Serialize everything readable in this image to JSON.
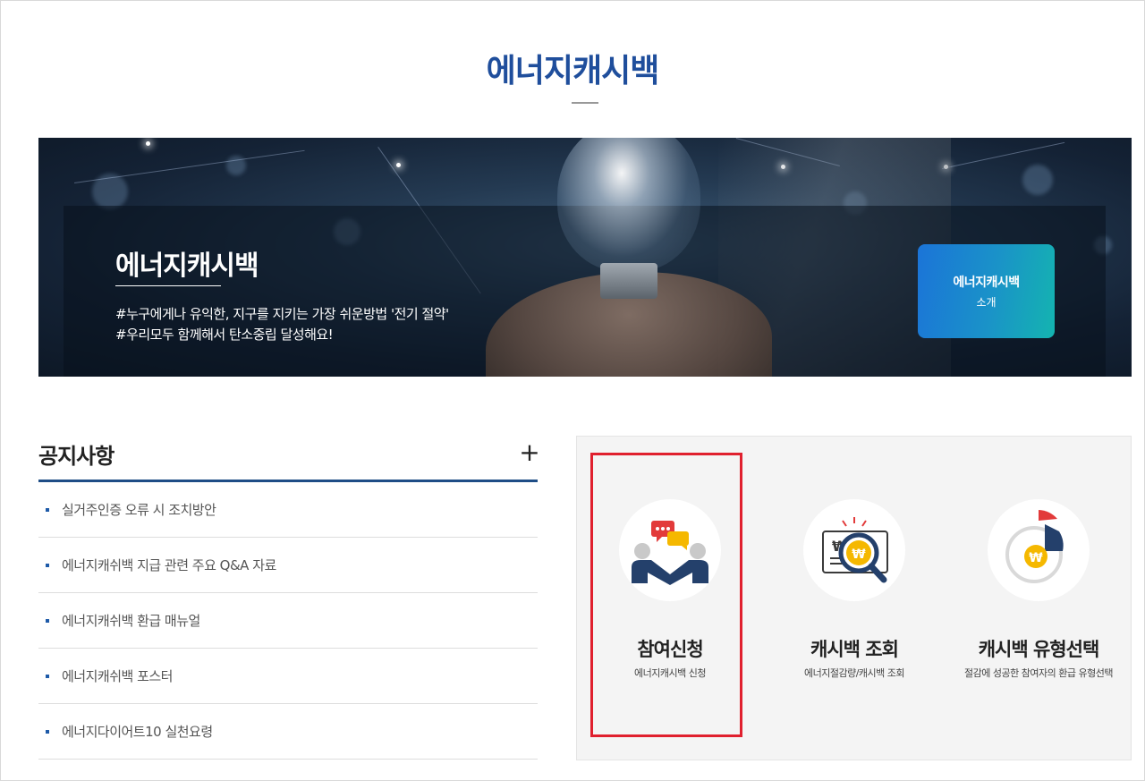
{
  "page": {
    "title": "에너지캐시백"
  },
  "banner": {
    "title": "에너지캐시백",
    "line1": "#누구에게나 유익한, 지구를 지키는 가장 쉬운방법 '전기 절약'",
    "line2": "#우리모두 함께해서 탄소중립 달성해요!",
    "intro_button": {
      "line1": "에너지캐시백",
      "line2": "소개"
    }
  },
  "notices": {
    "title": "공지사항",
    "more_symbol": "+",
    "items": [
      "실거주인증 오류 시 조치방안",
      "에너지캐쉬백 지급 관련 주요 Q&A 자료",
      "에너지캐쉬백 환급 매뉴얼",
      "에너지캐쉬백 포스터",
      "에너지다이어트10 실천요령"
    ]
  },
  "services": [
    {
      "name": "참여신청",
      "desc": "에너지캐시백 신청",
      "icon": "participation-chat-icon"
    },
    {
      "name": "캐시백 조회",
      "desc": "에너지절감량/캐시백 조회",
      "icon": "won-magnifier-icon"
    },
    {
      "name": "캐시백 유형선택",
      "desc": "절감에 성공한 참여자의 환급 유형선택",
      "icon": "won-pie-chart-icon"
    }
  ],
  "colors": {
    "title_blue": "#1f4e9c",
    "highlight_red": "#e0202e",
    "notice_rule": "#1e4d86"
  }
}
